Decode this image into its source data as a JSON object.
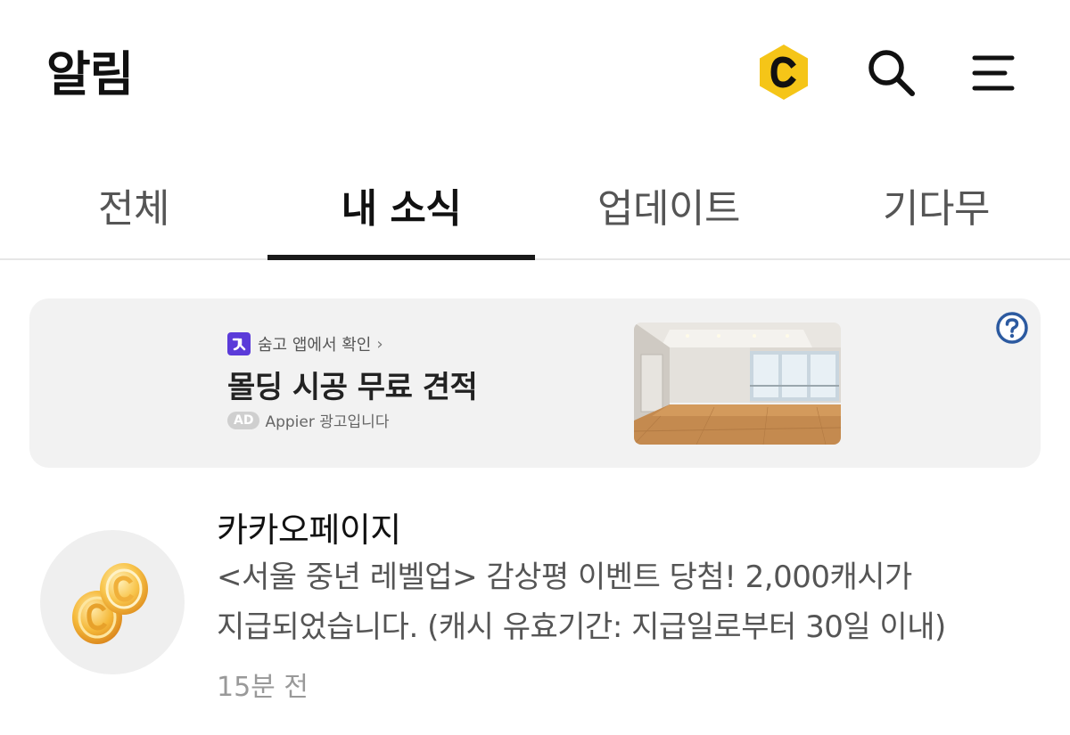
{
  "header": {
    "title": "알림",
    "icons": [
      "cash-icon",
      "search-icon",
      "menu-icon"
    ],
    "cash_icon_color": "#F5C518"
  },
  "tabs": [
    {
      "label": "전체",
      "active": false
    },
    {
      "label": "내 소식",
      "active": true
    },
    {
      "label": "업데이트",
      "active": false
    },
    {
      "label": "기다무",
      "active": false
    }
  ],
  "ad": {
    "brand": "숨고 앱에서 확인",
    "chevron": "›",
    "headline": "몰딩 시공 무료 견적",
    "badge": "AD",
    "advertiser": "Appier 광고입니다",
    "help_icon": "question-circle-icon",
    "accent_color": "#5B3BD9"
  },
  "notifications": [
    {
      "sender": "카카오페이지",
      "message_line1": "<서울 중년 레벨업> 감상평 이벤트 당첨! 2,000캐시가",
      "message_line2": "지급되었습니다. (캐시 유효기간: 지급일로부터 30일 이내)",
      "time": "15분 전",
      "avatar_icon": "gold-coins-icon"
    }
  ]
}
